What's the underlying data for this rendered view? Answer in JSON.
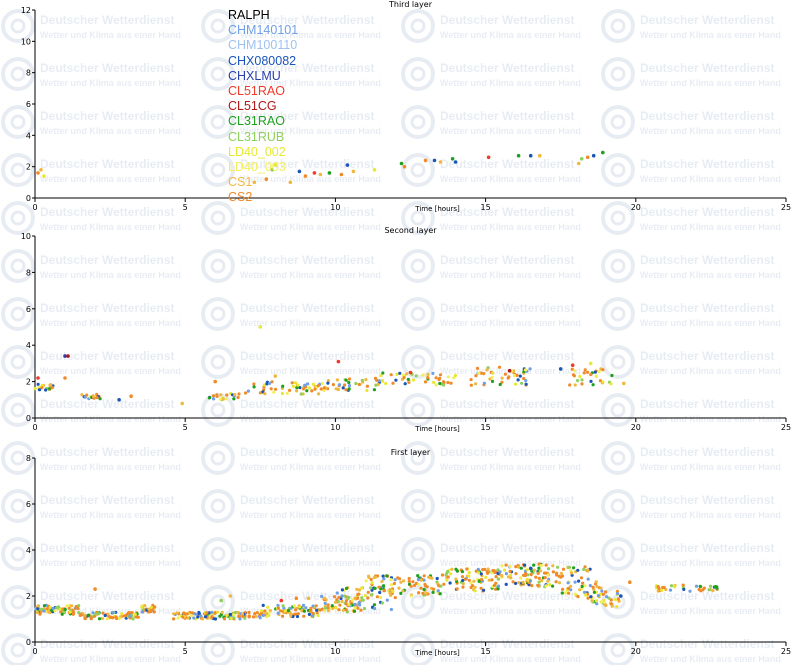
{
  "watermark": {
    "title": "Deutscher Wetterdienst",
    "subtitle": "Wetter und Klima aus einer Hand",
    "logo": "DWD"
  },
  "legend": [
    {
      "name": "RALPH",
      "color": "#000000"
    },
    {
      "name": "CHM140101",
      "color": "#6f9fe8"
    },
    {
      "name": "CHM100110",
      "color": "#9ec2f0"
    },
    {
      "name": "CHX080082",
      "color": "#1a55b8"
    },
    {
      "name": "CHXLMU",
      "color": "#2a3fa8"
    },
    {
      "name": "CL51RAO",
      "color": "#f03a2a"
    },
    {
      "name": "CL51CG",
      "color": "#b01818"
    },
    {
      "name": "CL31RAO",
      "color": "#1ea01e"
    },
    {
      "name": "CL31RUB",
      "color": "#8ed05c"
    },
    {
      "name": "LD40_002",
      "color": "#e8e832"
    },
    {
      "name": "LD40_003",
      "color": "#f4ee5a"
    },
    {
      "name": "CS1",
      "color": "#f0b840"
    },
    {
      "name": "CS2",
      "color": "#f08a2a"
    }
  ],
  "chart_data": [
    {
      "type": "scatter",
      "title": "Third layer",
      "xlabel": "Time [hours]",
      "ylabel": "",
      "xlim": [
        0,
        25
      ],
      "ylim": [
        0,
        12
      ],
      "xticks": [
        "0",
        "5",
        "10",
        "15",
        "20",
        "25"
      ],
      "yticks": [
        "0",
        "2",
        "4",
        "6",
        "8",
        "10",
        "12"
      ],
      "points": [
        {
          "x": 0.1,
          "y": 1.6,
          "s": "CS2"
        },
        {
          "x": 0.2,
          "y": 1.8,
          "s": "CS1"
        },
        {
          "x": 0.3,
          "y": 1.4,
          "s": "LD40_002"
        },
        {
          "x": 7.3,
          "y": 1.0,
          "s": "CS1"
        },
        {
          "x": 7.7,
          "y": 1.2,
          "s": "CS2"
        },
        {
          "x": 7.9,
          "y": 1.8,
          "s": "CL31RUB"
        },
        {
          "x": 8.0,
          "y": 2.1,
          "s": "LD40_002"
        },
        {
          "x": 8.5,
          "y": 1.0,
          "s": "CS1"
        },
        {
          "x": 8.8,
          "y": 1.7,
          "s": "CHX080082"
        },
        {
          "x": 9.0,
          "y": 1.4,
          "s": "CS2"
        },
        {
          "x": 9.3,
          "y": 1.6,
          "s": "CL51RAO"
        },
        {
          "x": 9.5,
          "y": 1.5,
          "s": "CS1"
        },
        {
          "x": 9.8,
          "y": 1.6,
          "s": "CL31RAO"
        },
        {
          "x": 10.2,
          "y": 1.5,
          "s": "CS2"
        },
        {
          "x": 10.4,
          "y": 2.1,
          "s": "CHX080082"
        },
        {
          "x": 10.6,
          "y": 1.7,
          "s": "CS1"
        },
        {
          "x": 11.3,
          "y": 1.8,
          "s": "LD40_002"
        },
        {
          "x": 12.2,
          "y": 2.2,
          "s": "CL31RAO"
        },
        {
          "x": 12.3,
          "y": 2.0,
          "s": "CS2"
        },
        {
          "x": 13.0,
          "y": 2.4,
          "s": "CS2"
        },
        {
          "x": 13.3,
          "y": 2.4,
          "s": "CHX080082"
        },
        {
          "x": 13.5,
          "y": 2.3,
          "s": "CS1"
        },
        {
          "x": 13.9,
          "y": 2.5,
          "s": "CL31RAO"
        },
        {
          "x": 14.0,
          "y": 2.3,
          "s": "CHX080082"
        },
        {
          "x": 15.1,
          "y": 2.6,
          "s": "CL51RAO"
        },
        {
          "x": 16.1,
          "y": 2.7,
          "s": "CL31RAO"
        },
        {
          "x": 16.5,
          "y": 2.7,
          "s": "CHX080082"
        },
        {
          "x": 16.8,
          "y": 2.7,
          "s": "CS1"
        },
        {
          "x": 18.1,
          "y": 2.2,
          "s": "CS1"
        },
        {
          "x": 18.2,
          "y": 2.5,
          "s": "CL31RUB"
        },
        {
          "x": 18.4,
          "y": 2.6,
          "s": "CS2"
        },
        {
          "x": 18.6,
          "y": 2.7,
          "s": "CHX080082"
        },
        {
          "x": 18.9,
          "y": 2.9,
          "s": "CL31RAO"
        }
      ]
    },
    {
      "type": "scatter",
      "title": "Second layer",
      "xlabel": "Time [hours]",
      "ylabel": "",
      "xlim": [
        0,
        25
      ],
      "ylim": [
        0,
        10
      ],
      "xticks": [
        "0",
        "5",
        "10",
        "15",
        "20",
        "25"
      ],
      "yticks": [
        "0",
        "2",
        "4",
        "6",
        "8",
        "10"
      ],
      "bands": [
        {
          "x0": 0.0,
          "x1": 0.6,
          "y0": 1.5,
          "y1": 1.9,
          "n": 22
        },
        {
          "x0": 1.5,
          "x1": 2.2,
          "y0": 1.0,
          "y1": 1.3,
          "n": 16
        },
        {
          "x0": 5.8,
          "x1": 7.0,
          "y0": 1.0,
          "y1": 1.4,
          "n": 20
        },
        {
          "x0": 7.0,
          "x1": 9.5,
          "y0": 1.3,
          "y1": 2.0,
          "n": 50
        },
        {
          "x0": 9.5,
          "x1": 11.5,
          "y0": 1.5,
          "y1": 2.2,
          "n": 40
        },
        {
          "x0": 11.5,
          "x1": 14.0,
          "y0": 1.8,
          "y1": 2.5,
          "n": 45
        },
        {
          "x0": 14.5,
          "x1": 16.5,
          "y0": 1.8,
          "y1": 2.8,
          "n": 45
        },
        {
          "x0": 17.8,
          "x1": 19.3,
          "y0": 1.8,
          "y1": 2.8,
          "n": 30
        }
      ],
      "points": [
        {
          "x": 0.1,
          "y": 2.2,
          "s": "CL51RAO"
        },
        {
          "x": 1.0,
          "y": 3.4,
          "s": "CHXLMU"
        },
        {
          "x": 1.1,
          "y": 3.4,
          "s": "CL51CG"
        },
        {
          "x": 1.0,
          "y": 2.2,
          "s": "CS2"
        },
        {
          "x": 2.8,
          "y": 1.0,
          "s": "CHX080082"
        },
        {
          "x": 3.2,
          "y": 1.2,
          "s": "CS2"
        },
        {
          "x": 4.9,
          "y": 0.8,
          "s": "CS1"
        },
        {
          "x": 6.0,
          "y": 2.0,
          "s": "CS2"
        },
        {
          "x": 7.5,
          "y": 5.0,
          "s": "LD40_002"
        },
        {
          "x": 8.0,
          "y": 2.3,
          "s": "CS1"
        },
        {
          "x": 10.1,
          "y": 3.1,
          "s": "CL51RAO"
        },
        {
          "x": 12.5,
          "y": 2.5,
          "s": "CL51RAO"
        },
        {
          "x": 15.8,
          "y": 2.6,
          "s": "CL51CG"
        },
        {
          "x": 17.5,
          "y": 2.7,
          "s": "CHX080082"
        },
        {
          "x": 17.9,
          "y": 2.9,
          "s": "CL51RAO"
        },
        {
          "x": 19.6,
          "y": 1.9,
          "s": "CS1"
        },
        {
          "x": 18.5,
          "y": 3.0,
          "s": "LD40_002"
        }
      ]
    },
    {
      "type": "scatter",
      "title": "First layer",
      "xlabel": "Time [hours]",
      "ylabel": "",
      "xlim": [
        0,
        25
      ],
      "ylim": [
        0,
        8
      ],
      "xticks": [
        "0",
        "5",
        "10",
        "15",
        "20",
        "25"
      ],
      "yticks": [
        "0",
        "2",
        "4",
        "6",
        "8"
      ],
      "bands": [
        {
          "x0": 0.0,
          "x1": 1.5,
          "y0": 1.2,
          "y1": 1.6,
          "n": 70
        },
        {
          "x0": 1.5,
          "x1": 3.5,
          "y0": 1.0,
          "y1": 1.3,
          "n": 80
        },
        {
          "x0": 3.5,
          "x1": 4.0,
          "y0": 1.3,
          "y1": 1.6,
          "n": 25
        },
        {
          "x0": 4.6,
          "x1": 7.5,
          "y0": 1.0,
          "y1": 1.3,
          "n": 110
        },
        {
          "x0": 7.5,
          "x1": 9.5,
          "y0": 1.1,
          "y1": 1.6,
          "n": 80
        },
        {
          "x0": 9.5,
          "x1": 11.0,
          "y0": 1.3,
          "y1": 2.0,
          "n": 60
        },
        {
          "x0": 10.0,
          "x1": 12.0,
          "y0": 1.4,
          "y1": 2.4,
          "n": 50
        },
        {
          "x0": 11.0,
          "x1": 13.5,
          "y0": 2.0,
          "y1": 2.9,
          "n": 90
        },
        {
          "x0": 13.5,
          "x1": 15.5,
          "y0": 2.2,
          "y1": 3.2,
          "n": 90
        },
        {
          "x0": 15.5,
          "x1": 17.5,
          "y0": 2.4,
          "y1": 3.4,
          "n": 90
        },
        {
          "x0": 17.5,
          "x1": 19.0,
          "y0": 1.9,
          "y1": 3.3,
          "n": 60
        },
        {
          "x0": 18.5,
          "x1": 19.5,
          "y0": 1.5,
          "y1": 2.2,
          "n": 30
        },
        {
          "x0": 20.5,
          "x1": 22.8,
          "y0": 2.2,
          "y1": 2.5,
          "n": 35
        }
      ],
      "points": [
        {
          "x": 2.0,
          "y": 2.3,
          "s": "CS2"
        },
        {
          "x": 6.2,
          "y": 1.8,
          "s": "CL31RUB"
        },
        {
          "x": 6.5,
          "y": 2.0,
          "s": "CS1"
        },
        {
          "x": 8.2,
          "y": 1.8,
          "s": "CL51RAO"
        },
        {
          "x": 8.7,
          "y": 1.9,
          "s": "CS2"
        },
        {
          "x": 9.1,
          "y": 1.9,
          "s": "CS1"
        },
        {
          "x": 16.5,
          "y": 3.2,
          "s": "CHX080082"
        },
        {
          "x": 19.5,
          "y": 2.0,
          "s": "CHX080082"
        },
        {
          "x": 19.0,
          "y": 1.6,
          "s": "CS1"
        },
        {
          "x": 19.8,
          "y": 2.6,
          "s": "CS2"
        }
      ]
    }
  ]
}
